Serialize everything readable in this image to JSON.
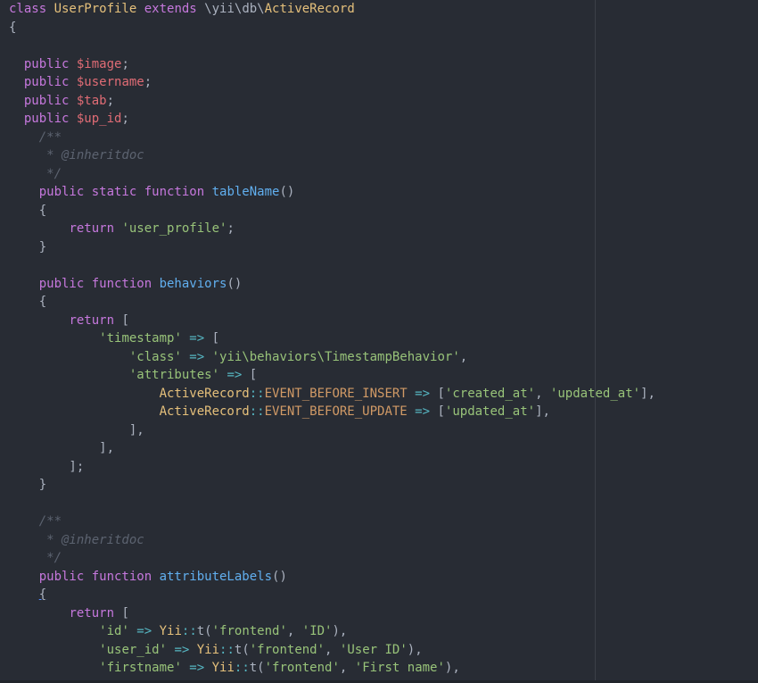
{
  "editor": {
    "lines": [
      [
        [
          "kw",
          "class "
        ],
        [
          "cls",
          "UserProfile "
        ],
        [
          "kw",
          "extends "
        ],
        [
          "ns",
          "\\yii\\db\\"
        ],
        [
          "cls",
          "ActiveRecord"
        ]
      ],
      [
        [
          "pun",
          "{"
        ]
      ],
      [],
      [
        [
          "pun",
          "  "
        ],
        [
          "kw",
          "public "
        ],
        [
          "var",
          "$image"
        ],
        [
          "pun",
          ";"
        ]
      ],
      [
        [
          "pun",
          "  "
        ],
        [
          "kw",
          "public "
        ],
        [
          "var",
          "$username"
        ],
        [
          "pun",
          ";"
        ]
      ],
      [
        [
          "pun",
          "  "
        ],
        [
          "kw",
          "public "
        ],
        [
          "var",
          "$tab"
        ],
        [
          "pun",
          ";"
        ]
      ],
      [
        [
          "pun",
          "  "
        ],
        [
          "kw",
          "public "
        ],
        [
          "var",
          "$up_id"
        ],
        [
          "pun",
          ";"
        ]
      ],
      [
        [
          "cm",
          "    /**"
        ]
      ],
      [
        [
          "cm",
          "     * @inheritdoc"
        ]
      ],
      [
        [
          "cm",
          "     */"
        ]
      ],
      [
        [
          "pun",
          "    "
        ],
        [
          "kw",
          "public static function "
        ],
        [
          "fn",
          "tableName"
        ],
        [
          "pun",
          "()"
        ]
      ],
      [
        [
          "pun",
          "    {"
        ]
      ],
      [
        [
          "pun",
          "        "
        ],
        [
          "kw",
          "return "
        ],
        [
          "str",
          "'user_profile'"
        ],
        [
          "pun",
          ";"
        ]
      ],
      [
        [
          "pun",
          "    }"
        ]
      ],
      [],
      [
        [
          "pun",
          "    "
        ],
        [
          "kw",
          "public function "
        ],
        [
          "fn",
          "behaviors"
        ],
        [
          "pun",
          "()"
        ]
      ],
      [
        [
          "pun",
          "    {"
        ]
      ],
      [
        [
          "pun",
          "        "
        ],
        [
          "kw",
          "return "
        ],
        [
          "pun",
          "["
        ]
      ],
      [
        [
          "pun",
          "            "
        ],
        [
          "str",
          "'timestamp'"
        ],
        [
          "op",
          " => "
        ],
        [
          "pun",
          "["
        ]
      ],
      [
        [
          "pun",
          "                "
        ],
        [
          "str",
          "'class'"
        ],
        [
          "op",
          " => "
        ],
        [
          "str",
          "'yii\\behaviors\\TimestampBehavior'"
        ],
        [
          "pun",
          ","
        ]
      ],
      [
        [
          "pun",
          "                "
        ],
        [
          "str",
          "'attributes'"
        ],
        [
          "op",
          " => "
        ],
        [
          "pun",
          "["
        ]
      ],
      [
        [
          "pun",
          "                    "
        ],
        [
          "cls",
          "ActiveRecord"
        ],
        [
          "op",
          "::"
        ],
        [
          "const",
          "EVENT_BEFORE_INSERT"
        ],
        [
          "op",
          " => "
        ],
        [
          "pun",
          "["
        ],
        [
          "str",
          "'created_at'"
        ],
        [
          "pun",
          ", "
        ],
        [
          "str",
          "'updated_at'"
        ],
        [
          "pun",
          "],"
        ]
      ],
      [
        [
          "pun",
          "                    "
        ],
        [
          "cls",
          "ActiveRecord"
        ],
        [
          "op",
          "::"
        ],
        [
          "const",
          "EVENT_BEFORE_UPDATE"
        ],
        [
          "op",
          " => "
        ],
        [
          "pun",
          "["
        ],
        [
          "str",
          "'updated_at'"
        ],
        [
          "pun",
          "],"
        ]
      ],
      [
        [
          "pun",
          "                ],"
        ]
      ],
      [
        [
          "pun",
          "            ],"
        ]
      ],
      [
        [
          "pun",
          "        ];"
        ]
      ],
      [
        [
          "pun",
          "    }"
        ]
      ],
      [],
      [
        [
          "cm",
          "    /**"
        ]
      ],
      [
        [
          "cm",
          "     * @inheritdoc"
        ]
      ],
      [
        [
          "cm",
          "     */"
        ]
      ],
      [
        [
          "pun",
          "    "
        ],
        [
          "kw",
          "public function "
        ],
        [
          "fn",
          "attributeLabels"
        ],
        [
          "pun",
          "()"
        ]
      ],
      [
        [
          "pun",
          "    {"
        ]
      ],
      [
        [
          "pun",
          "        "
        ],
        [
          "kw",
          "return "
        ],
        [
          "pun",
          "["
        ]
      ],
      [
        [
          "pun",
          "            "
        ],
        [
          "str",
          "'id'"
        ],
        [
          "op",
          " => "
        ],
        [
          "cls",
          "Yii"
        ],
        [
          "op",
          "::"
        ],
        [
          "pun",
          "t("
        ],
        [
          "str",
          "'frontend'"
        ],
        [
          "pun",
          ", "
        ],
        [
          "str",
          "'ID'"
        ],
        [
          "pun",
          "),"
        ]
      ],
      [
        [
          "pun",
          "            "
        ],
        [
          "str",
          "'user_id'"
        ],
        [
          "op",
          " => "
        ],
        [
          "cls",
          "Yii"
        ],
        [
          "op",
          "::"
        ],
        [
          "pun",
          "t("
        ],
        [
          "str",
          "'frontend'"
        ],
        [
          "pun",
          ", "
        ],
        [
          "str",
          "'User ID'"
        ],
        [
          "pun",
          "),"
        ]
      ],
      [
        [
          "pun",
          "            "
        ],
        [
          "str",
          "'firstname'"
        ],
        [
          "op",
          " => "
        ],
        [
          "cls",
          "Yii"
        ],
        [
          "op",
          "::"
        ],
        [
          "pun",
          "t("
        ],
        [
          "str",
          "'frontend'"
        ],
        [
          "pun",
          ", "
        ],
        [
          "str",
          "'First name'"
        ],
        [
          "pun",
          "),"
        ]
      ]
    ],
    "colors": {
      "background": "#282c34",
      "keyword": "#c678dd",
      "class_name": "#e5c07b",
      "variable": "#e06c75",
      "function": "#61afef",
      "string": "#98c379",
      "constant": "#d19a66",
      "comment": "#5c6370",
      "operator": "#56b6c2",
      "default": "#abb2bf"
    }
  }
}
